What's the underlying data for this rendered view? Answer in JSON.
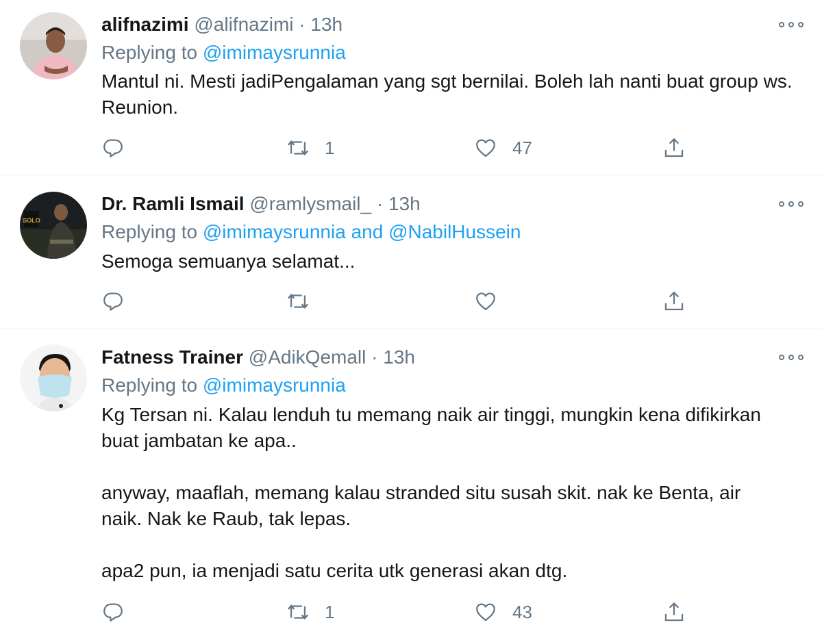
{
  "tweets": [
    {
      "name": "alifnazimi",
      "handle": "@alifnazimi",
      "dot": "·",
      "time": "13h",
      "replying_prefix": "Replying to",
      "mention1": "@imimaysrunnia",
      "and": "",
      "mention2": "",
      "text1": "Mantul ni. Mesti jadiPengalaman yang sgt bernilai. Boleh lah nanti buat group ws. Reunion.",
      "text2": "",
      "text3": "",
      "reply_count": "",
      "retweet_count": "1",
      "like_count": "47"
    },
    {
      "name": "Dr. Ramli Ismail",
      "handle": "@ramlysmail_",
      "dot": "·",
      "time": "13h",
      "replying_prefix": "Replying to",
      "mention1": "@imimaysrunnia",
      "and": "and",
      "mention2": "@NabilHussein",
      "text1": "Semoga semuanya selamat...",
      "text2": "",
      "text3": "",
      "reply_count": "",
      "retweet_count": "",
      "like_count": ""
    },
    {
      "name": "Fatness Trainer",
      "handle": "@AdikQemall",
      "dot": "·",
      "time": "13h",
      "replying_prefix": "Replying to",
      "mention1": "@imimaysrunnia",
      "and": "",
      "mention2": "",
      "text1": "Kg Tersan ni. Kalau lenduh tu memang naik air tinggi, mungkin kena difikirkan buat jambatan ke apa..",
      "text2": "anyway, maaflah, memang kalau stranded situ susah skit. nak ke Benta, air naik. Nak ke Raub, tak lepas.",
      "text3": "apa2 pun, ia menjadi satu cerita utk generasi akan dtg.",
      "reply_count": "",
      "retweet_count": "1",
      "like_count": "43"
    }
  ],
  "icons": {
    "reply": "reply-icon",
    "retweet": "retweet-icon",
    "like": "heart-icon",
    "share": "share-icon",
    "more": "more-icon"
  },
  "colors": {
    "link": "#1da1f2",
    "muted": "#657786",
    "text": "#14171a",
    "divider": "#e6ecf0"
  }
}
